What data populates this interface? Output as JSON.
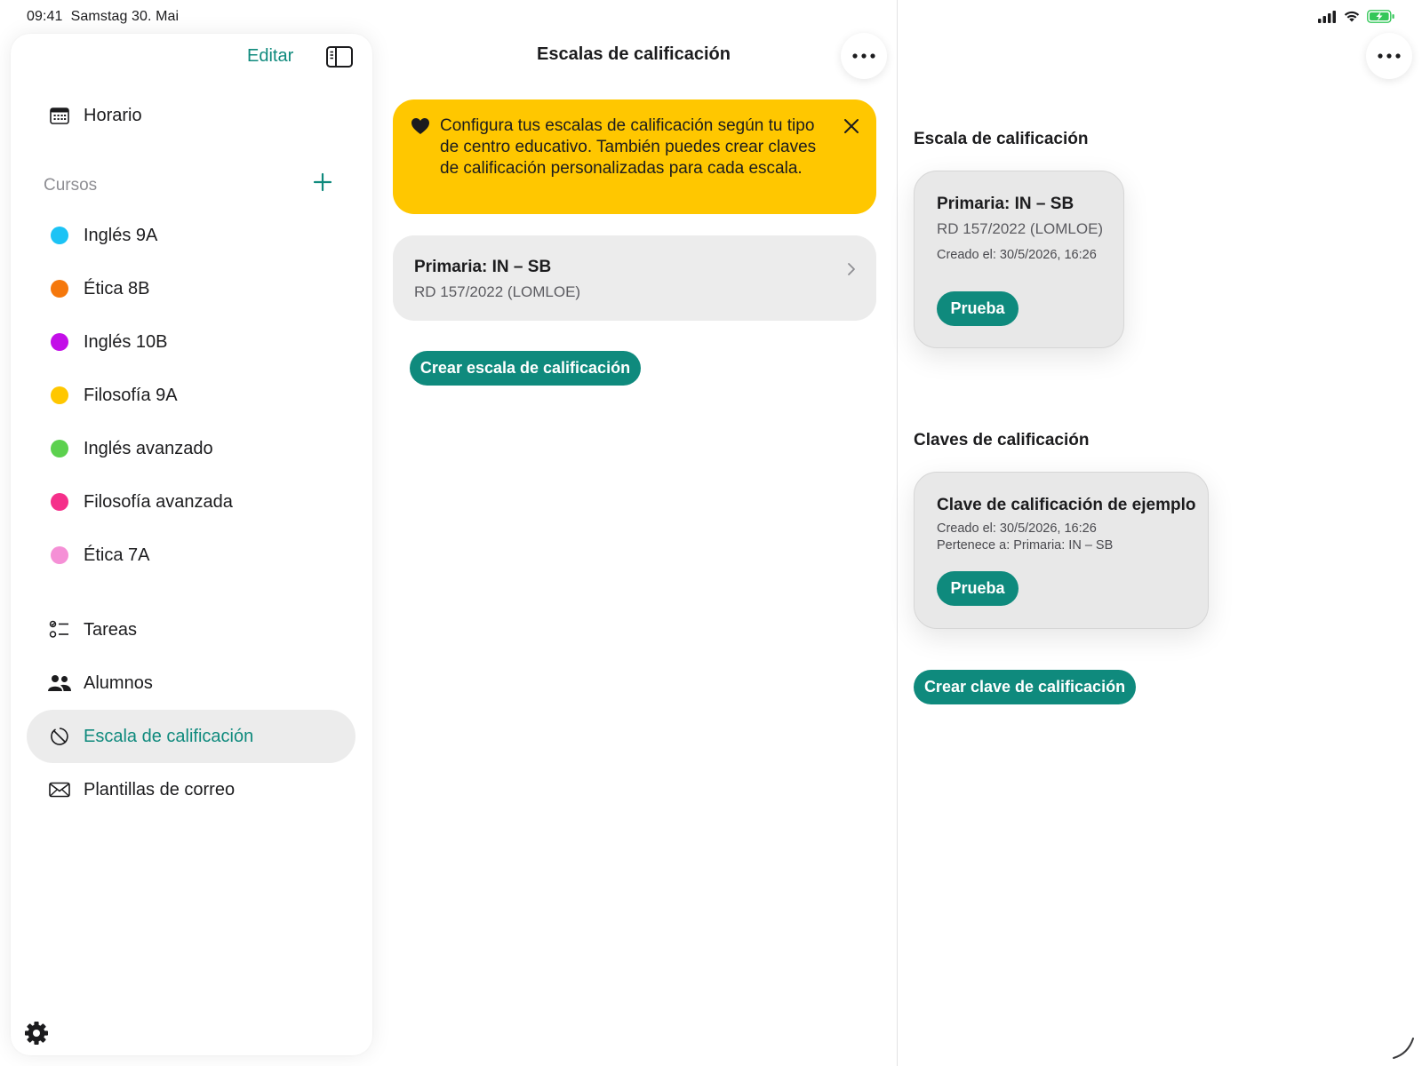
{
  "status_bar": {
    "time": "09:41",
    "date": "Samstag 30. Mai"
  },
  "sidebar": {
    "edit_label": "Editar",
    "top_item": {
      "label": "Horario",
      "icon": "calendar-icon"
    },
    "courses_header": "Cursos",
    "courses": [
      {
        "label": "Inglés 9A",
        "color": "#1cc3f5"
      },
      {
        "label": "Ética 8B",
        "color": "#f5780c"
      },
      {
        "label": "Inglés 10B",
        "color": "#c30ee8"
      },
      {
        "label": "Filosofía 9A",
        "color": "#ffc700"
      },
      {
        "label": "Inglés avanzado",
        "color": "#5cd14e"
      },
      {
        "label": "Filosofía avanzada",
        "color": "#f52f8a"
      },
      {
        "label": "Ética 7A",
        "color": "#f590d6"
      }
    ],
    "nav": [
      {
        "label": "Tareas",
        "icon": "tasks-icon"
      },
      {
        "label": "Alumnos",
        "icon": "people-icon"
      },
      {
        "label": "Escala de calificación",
        "icon": "grading-scale-icon",
        "active": true
      },
      {
        "label": "Plantillas de correo",
        "icon": "envelope-icon"
      }
    ]
  },
  "middle": {
    "title": "Escalas de calificación",
    "banner_text": "Configura tus escalas de calificación según tu tipo de centro educativo. También puedes crear claves de calificación personalizadas para cada escala.",
    "scale_item": {
      "title": "Primaria: IN – SB",
      "subtitle": "RD 157/2022 (LOMLOE)"
    },
    "create_scale_button": "Crear escala de calificación"
  },
  "detail": {
    "scale_heading": "Escala de calificación",
    "scale_card": {
      "title": "Primaria: IN – SB",
      "subtitle": "RD 157/2022 (LOMLOE)",
      "created": "Creado el: 30/5/2026, 16:26",
      "button": "Prueba"
    },
    "keys_heading": "Claves de calificación",
    "key_card": {
      "title": "Clave de calificación de ejemplo",
      "created": "Creado el: 30/5/2026, 16:26",
      "belongs": "Pertenece a: Primaria: IN – SB",
      "button": "Prueba"
    },
    "create_key_button": "Crear clave de calificación"
  },
  "colors": {
    "accent": "#0f8a7d",
    "banner": "#ffc700"
  }
}
